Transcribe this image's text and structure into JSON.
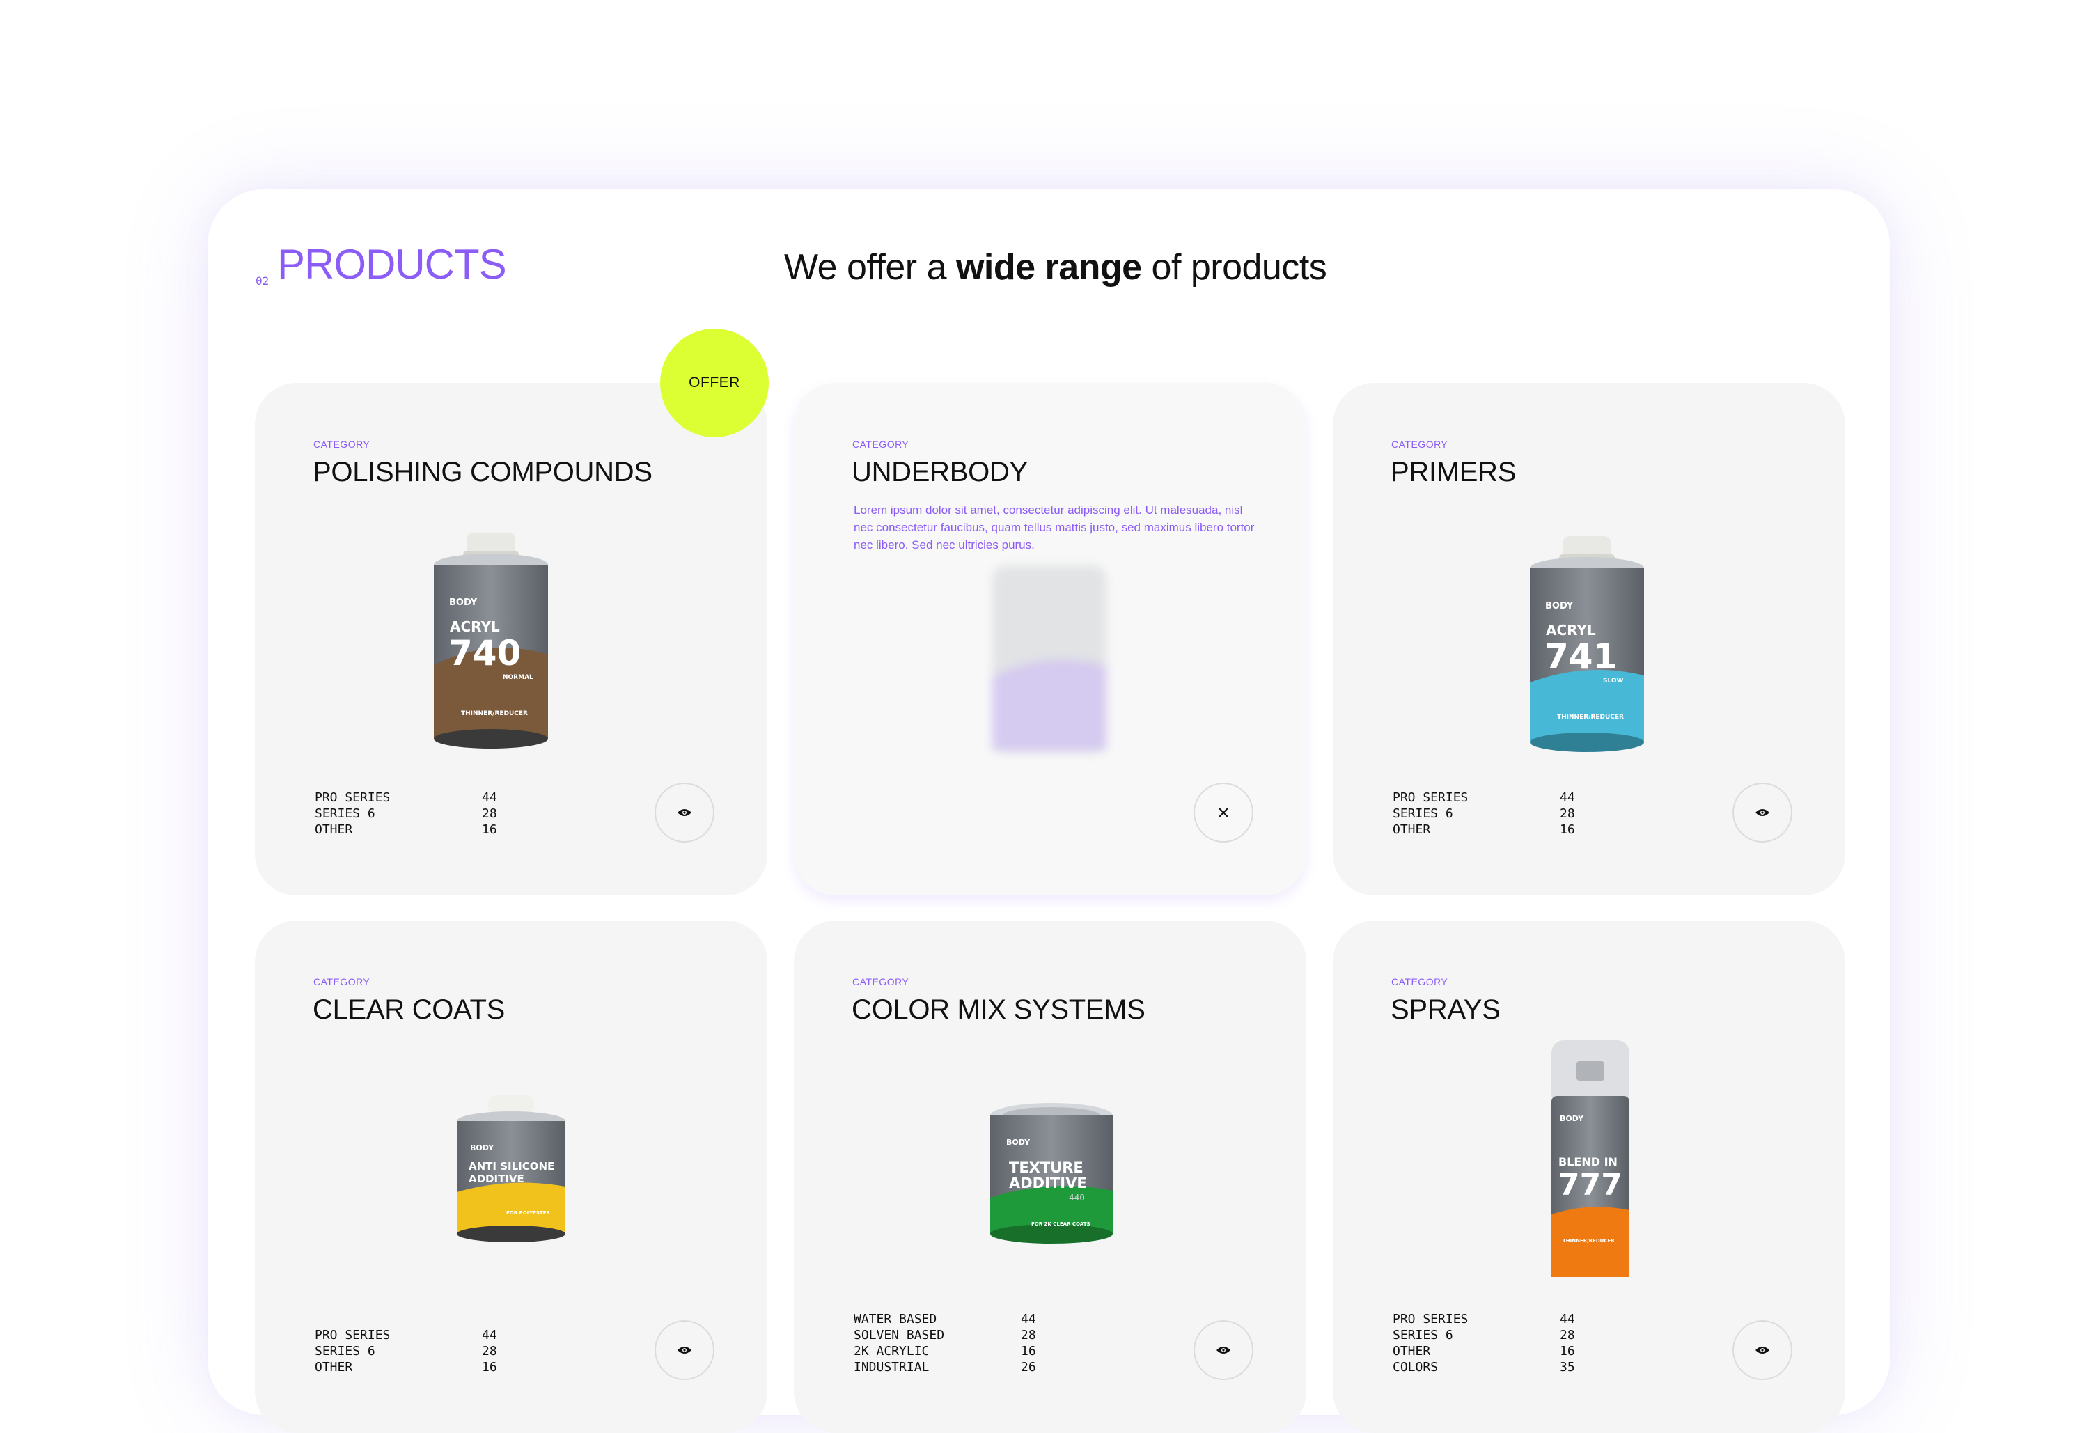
{
  "section": {
    "number": "02",
    "title": "PRODUCTS"
  },
  "headline": {
    "prefix": "We offer a ",
    "bold": "wide range",
    "suffix": " of products"
  },
  "offer_badge": "OFFER",
  "cards": [
    {
      "category": "CATEGORY",
      "title": "POLISHING COMPOUNDS",
      "product": {
        "brand": "BODY",
        "line1": "ACRYL",
        "number": "740",
        "sub": "NORMAL",
        "footer": "THINNER/REDUCER"
      },
      "stats": [
        {
          "label": "PRO SERIES",
          "value": "44"
        },
        {
          "label": "SERIES 6",
          "value": "28"
        },
        {
          "label": "OTHER",
          "value": "16"
        }
      ],
      "button_icon": "eye-icon"
    },
    {
      "category": "CATEGORY",
      "title": "UNDERBODY",
      "description": "Lorem ipsum dolor sit amet, consectetur adipiscing elit. Ut malesuada, nisl nec consectetur faucibus, quam tellus mattis justo, sed maximus libero tortor nec libero. Sed nec ultricies purus.",
      "button_icon": "close-icon"
    },
    {
      "category": "CATEGORY",
      "title": "PRIMERS",
      "product": {
        "brand": "BODY",
        "line1": "ACRYL",
        "number": "741",
        "sub": "SLOW",
        "footer": "THINNER/REDUCER"
      },
      "stats": [
        {
          "label": "PRO SERIES",
          "value": "44"
        },
        {
          "label": "SERIES 6",
          "value": "28"
        },
        {
          "label": "OTHER",
          "value": "16"
        }
      ],
      "button_icon": "eye-icon"
    },
    {
      "category": "CATEGORY",
      "title": "CLEAR COATS",
      "product": {
        "brand": "BODY",
        "line1": "ANTI SILICONE",
        "line2": "ADDITIVE",
        "footer": "FOR POLYESTER"
      },
      "stats": [
        {
          "label": "PRO SERIES",
          "value": "44"
        },
        {
          "label": "SERIES 6",
          "value": "28"
        },
        {
          "label": "OTHER",
          "value": "16"
        }
      ],
      "button_icon": "eye-icon"
    },
    {
      "category": "CATEGORY",
      "title": "COLOR MIX SYSTEMS",
      "product": {
        "brand": "BODY",
        "line1": "TEXTURE",
        "line2": "ADDITIVE",
        "number": "440",
        "footer": "FOR 2K CLEAR COATS"
      },
      "stats": [
        {
          "label": "WATER BASED",
          "value": "44"
        },
        {
          "label": "SOLVEN BASED",
          "value": "28"
        },
        {
          "label": "2K ACRYLIC",
          "value": "16"
        },
        {
          "label": "INDUSTRIAL",
          "value": "26"
        }
      ],
      "button_icon": "eye-icon"
    },
    {
      "category": "CATEGORY",
      "title": "SPRAYS",
      "product": {
        "brand": "BODY",
        "line1": "BLEND IN",
        "number": "777",
        "footer": "THINNER/REDUCER"
      },
      "stats": [
        {
          "label": "PRO SERIES",
          "value": "44"
        },
        {
          "label": "SERIES 6",
          "value": "28"
        },
        {
          "label": "OTHER",
          "value": "16"
        },
        {
          "label": "COLORS",
          "value": "35"
        }
      ],
      "button_icon": "eye-icon"
    }
  ],
  "colors": {
    "accent": "#8b5cf6",
    "offer": "#dcff33",
    "card": "#f5f5f5",
    "brown": "#7a5a3a",
    "cyan": "#47b8d6",
    "yellow": "#f2c21c",
    "green": "#1f9a3a",
    "orange": "#f07a12"
  }
}
